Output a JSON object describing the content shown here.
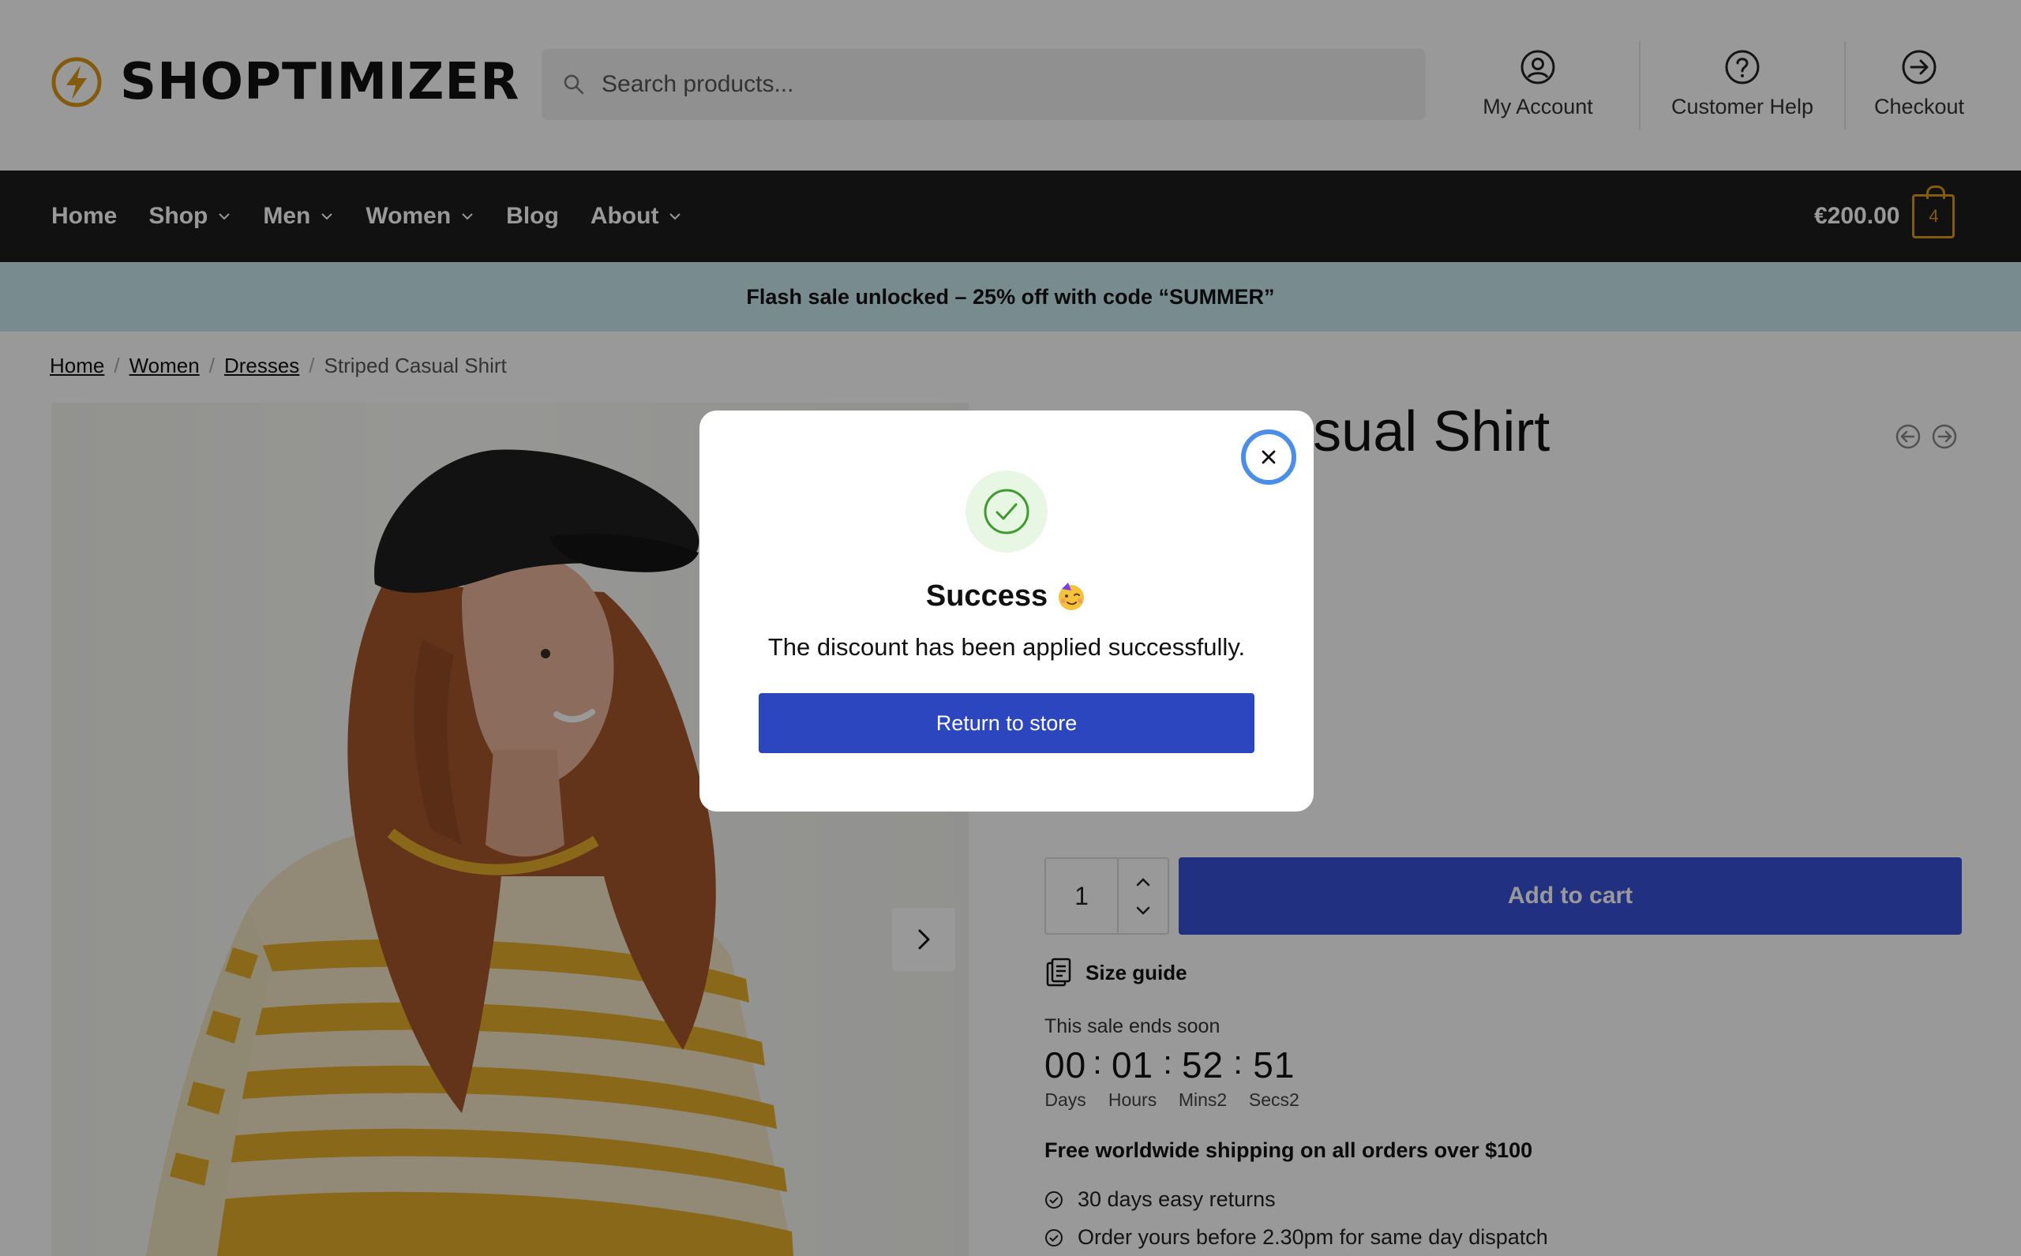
{
  "header": {
    "logo_text": "SHOPTIMIZER",
    "search_placeholder": "Search products...",
    "links": {
      "account": "My Account",
      "help": "Customer Help",
      "checkout": "Checkout"
    }
  },
  "nav": {
    "items": [
      {
        "label": "Home",
        "has_dropdown": false
      },
      {
        "label": "Shop",
        "has_dropdown": true
      },
      {
        "label": "Men",
        "has_dropdown": true
      },
      {
        "label": "Women",
        "has_dropdown": true
      },
      {
        "label": "Blog",
        "has_dropdown": false
      },
      {
        "label": "About",
        "has_dropdown": true
      }
    ],
    "cart_total": "€200.00",
    "cart_count": "4"
  },
  "banner": {
    "text": "Flash sale unlocked – 25% off with code “SUMMER”"
  },
  "breadcrumb": {
    "items": [
      "Home",
      "Women",
      "Dresses"
    ],
    "current": "Striped Casual Shirt"
  },
  "product": {
    "title_visible": "sual Shirt",
    "add_to_cart": "Add to cart",
    "quantity": "1",
    "size_guide": "Size guide",
    "sale_label": "This sale ends soon",
    "countdown": {
      "days": "00",
      "hours": "01",
      "mins": "52",
      "secs": "51",
      "days_label": "Days",
      "hours_label": "Hours",
      "mins_label": "Mins2",
      "secs_label": "Secs2"
    },
    "shipping": "Free worldwide shipping on all orders over $100",
    "usps": [
      "30 days easy returns",
      "Order yours before 2.30pm for same day dispatch"
    ]
  },
  "modal": {
    "title": "Success",
    "message": "The discount has been applied successfully.",
    "button": "Return to store"
  },
  "colors": {
    "accent": "#3a50d8",
    "modal_button": "#2c46c0",
    "banner_bg": "#c8e8ef",
    "nav_bg": "#1d1d1d",
    "cart_badge": "#dc9814",
    "success_green": "#3e9b2e",
    "close_ring": "#4a8ee8"
  },
  "icons": {
    "logo": "lightning-bolt-circle-icon",
    "search": "search-icon",
    "account": "user-circle-icon",
    "help": "question-circle-icon",
    "checkout": "arrow-right-circle-icon",
    "close": "close-icon",
    "success": "check-circle-icon"
  }
}
